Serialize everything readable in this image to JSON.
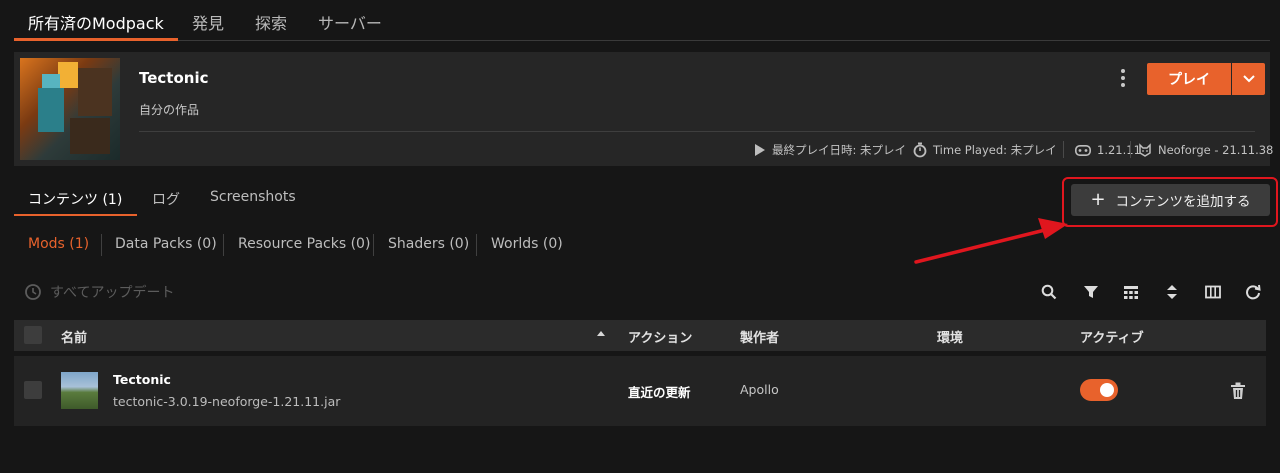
{
  "nav": {
    "tabs": [
      {
        "label": "所有済のModpack",
        "active": true
      },
      {
        "label": "発見",
        "active": false
      },
      {
        "label": "探索",
        "active": false
      },
      {
        "label": "サーバー",
        "active": false
      }
    ]
  },
  "modpack": {
    "title": "Tectonic",
    "subtitle": "自分の作品",
    "play_label": "プレイ",
    "last_played_label": "最終プレイ日時: 未プレイ",
    "time_played_label": "Time Played: 未プレイ",
    "game_version": "1.21.11",
    "loader": "Neoforge - 21.11.38",
    "icons": {
      "more": "more-vertical-icon",
      "play": "play-icon",
      "timer": "stopwatch-icon",
      "game": "gamepad-icon",
      "loader": "neoforge-icon",
      "dropdown": "chevron-down-icon"
    }
  },
  "content_tabs": [
    {
      "label": "コンテンツ (1)",
      "active": true
    },
    {
      "label": "ログ",
      "active": false
    },
    {
      "label": "Screenshots",
      "active": false
    }
  ],
  "add_content_label": "コンテンツを追加する",
  "filters": [
    {
      "label": "Mods (1)",
      "active": true
    },
    {
      "label": "Data Packs (0)",
      "active": false
    },
    {
      "label": "Resource Packs (0)",
      "active": false
    },
    {
      "label": "Shaders (0)",
      "active": false
    },
    {
      "label": "Worlds (0)",
      "active": false
    }
  ],
  "update_all_label": "すべてアップデート",
  "toolbar_icons": [
    "search-icon",
    "filter-icon",
    "grid-icon",
    "sort-icon",
    "columns-icon",
    "refresh-icon"
  ],
  "table": {
    "headers": {
      "name": "名前",
      "action": "アクション",
      "author": "製作者",
      "env": "環境",
      "active": "アクティブ"
    },
    "rows": [
      {
        "name": "Tectonic",
        "file": "tectonic-3.0.19-neoforge-1.21.11.jar",
        "action": "直近の更新",
        "author": "Apollo",
        "env": "",
        "active": true
      }
    ]
  },
  "colors": {
    "accent": "#e8622c",
    "highlight": "#e0161e",
    "background": "#161616",
    "card": "#262626"
  }
}
